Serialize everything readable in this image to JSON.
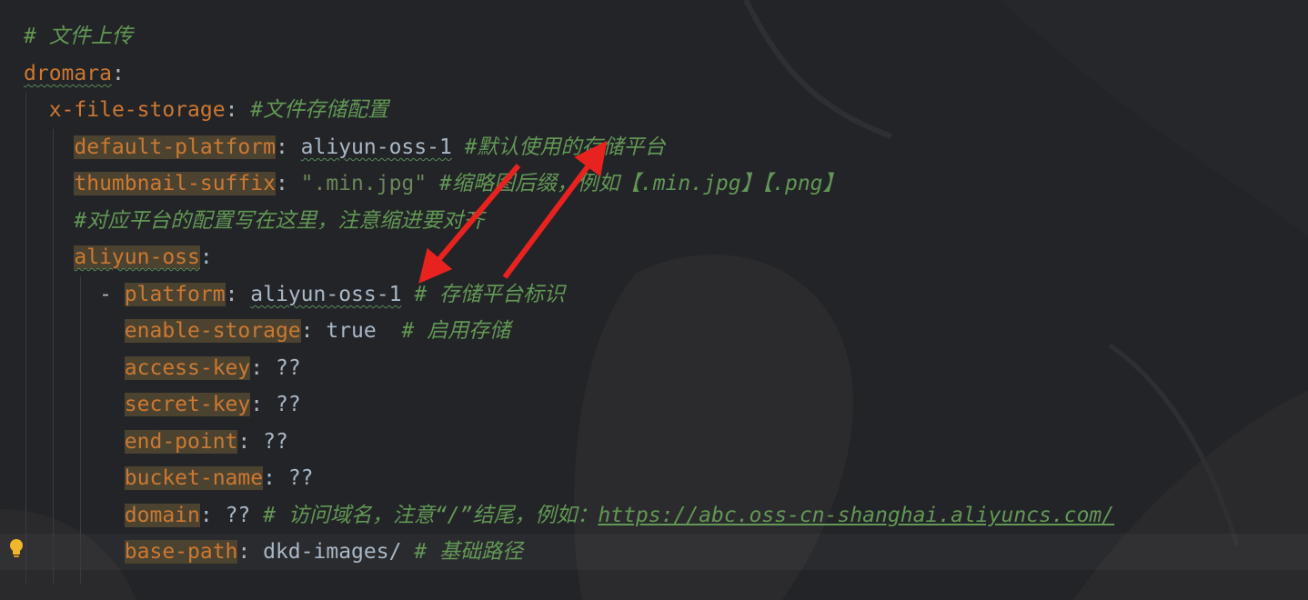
{
  "lines": {
    "l1_comment": "# 文件上传",
    "l2_key": "dromara",
    "l3_key": "x-file-storage",
    "l3_comment": "#文件存储配置",
    "l4_key": "default-platform",
    "l4_value": "aliyun-oss-1",
    "l4_comment": "#默认使用的存储平台",
    "l5_key": "thumbnail-suffix",
    "l5_value": "\".min.jpg\"",
    "l5_comment": "#缩略图后缀，例如【.min.jpg】【.png】",
    "l6_comment": "#对应平台的配置写在这里，注意缩进要对齐",
    "l7_key": "aliyun-oss",
    "l8_dash": "- ",
    "l8_key": "platform",
    "l8_value": "aliyun-oss-1",
    "l8_comment": "# 存储平台标识",
    "l9_key": "enable-storage",
    "l9_value": "true",
    "l9_comment": "# 启用存储",
    "l10_key": "access-key",
    "l10_value": "??",
    "l11_key": "secret-key",
    "l11_value": "??",
    "l12_key": "end-point",
    "l12_value": "??",
    "l13_key": "bucket-name",
    "l13_value": "??",
    "l14_key": "domain",
    "l14_value": "??",
    "l14_comment": "# 访问域名，注意“/”结尾，例如：",
    "l14_url": "https://abc.oss-cn-shanghai.aliyuncs.com/",
    "l15_key": "base-path",
    "l15_value": "dkd-images/",
    "l15_comment": "# 基础路径"
  },
  "colors": {
    "background": "#232427",
    "key": "#cc7832",
    "key_highlight": "#4b4330",
    "comment": "#629755",
    "text": "#a9b7c6",
    "annotation_arrow": "#e8231f"
  },
  "icons": {
    "gutter": "lightbulb-icon"
  }
}
